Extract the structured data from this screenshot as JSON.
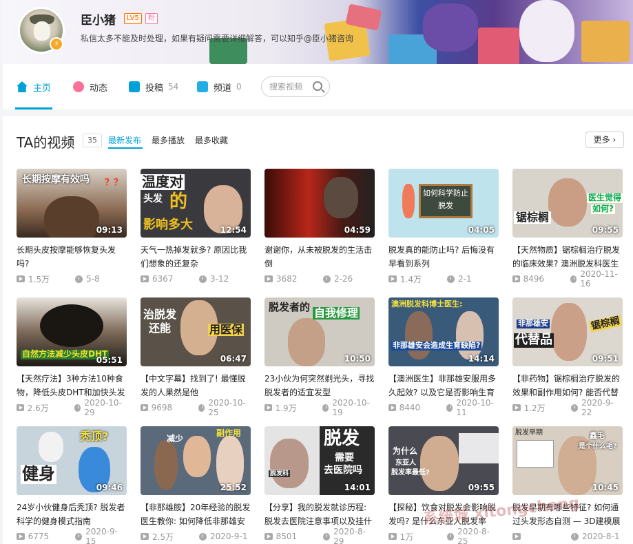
{
  "profile": {
    "name": "臣小猪",
    "level": "LV5",
    "fan_badge": "粉",
    "signature": "私信太多不能及时处理，如果有疑问需要详细解答，可以知乎@臣小猪咨询"
  },
  "nav": {
    "home": "主页",
    "dynamic": "动态",
    "uploads": "投稿",
    "uploads_count": "54",
    "channels": "频道",
    "channels_count": "0",
    "search_placeholder": "搜索视频"
  },
  "section": {
    "title": "TA的视频",
    "count": "35",
    "sort_latest": "最新发布",
    "sort_most_played": "最多播放",
    "sort_most_fav": "最多收藏",
    "more": "更多"
  },
  "videos": [
    {
      "title": "长期头皮按摩能够恢复头发吗?",
      "views": "1.5万",
      "date": "5-8",
      "duration": "09:13",
      "caption": "长期按摩有效吗",
      "caption2": "？？"
    },
    {
      "title": "天气一热掉发就多? 原因比我们想象的还复杂",
      "views": "6367",
      "date": "3-12",
      "duration": "12:54",
      "caption": "温度对",
      "caption2": "头发",
      "caption3": "的",
      "caption4": "影响多大"
    },
    {
      "title": "谢谢你，从未被脱发的生活击倒",
      "views": "3682",
      "date": "2-26",
      "duration": "04:59"
    },
    {
      "title": "脱发真的能防止吗? 后悔没有早看到系列",
      "views": "1.4万",
      "date": "2-1",
      "duration": "04:05",
      "caption": "如何科学防止",
      "caption2": "脱发"
    },
    {
      "title": "【天然物质】锯棕榈治疗脱发的临床效果? 澳洲脱发科医生",
      "views": "8496",
      "date": "2020-11-16",
      "duration": "09:55",
      "caption": "锯棕榈",
      "caption2": "医生觉得",
      "caption3": "如何?"
    },
    {
      "title": "【天然疗法】3种方法10种食物，降低头皮DHT和加快头发",
      "views": "2.6万",
      "date": "2020-10-29",
      "duration": "05:51",
      "caption": "自然方法减少头皮DHT"
    },
    {
      "title": "【中文字幕】找到了! 最懂脱发的人果然是他",
      "views": "9698",
      "date": "2020-10-25",
      "duration": "06:47",
      "caption": "治脱发",
      "caption2": "还能",
      "caption3": "用医保"
    },
    {
      "title": "23小伙为何突然剃光头，寻找脱发者的适宜发型",
      "views": "1.9万",
      "date": "2020-10-19",
      "duration": "10:50",
      "caption": "脱发者的",
      "caption2": "自我修理"
    },
    {
      "title": "【澳洲医生】非那雄安服用多久起效? 以及它是否影响生育",
      "views": "8440",
      "date": "2020-10-11",
      "duration": "14:14",
      "caption": "澳洲脱发科博士医生:",
      "caption2": "非那雄安会造成生育缺陷?"
    },
    {
      "title": "【非药物】锯棕榈治疗脱发的效果和副作用如何? 能否代替",
      "views": "1.2万",
      "date": "2020-9-22",
      "duration": "09:51",
      "caption": "非那雄安",
      "caption2": "代替品",
      "caption3": "锯棕榈"
    },
    {
      "title": "24岁小伙健身后秃顶? 脱发者科学的健身模式指南",
      "views": "6775",
      "date": "2020-9-15",
      "duration": "09:46",
      "caption": "秃顶?",
      "caption2": "健身"
    },
    {
      "title": "【非那雄胺】20年经验的脱发医生教你: 如何降低非那雄安",
      "views": "2.5万",
      "date": "2020-9-1",
      "duration": "25:52",
      "caption": "减少",
      "caption2": "副作用"
    },
    {
      "title": "【分享】我的脱发就诊历程: 脱发去医院注意事项以及挂什",
      "views": "8501",
      "date": "2020-8-29",
      "duration": "14:01",
      "caption": "脱发",
      "caption2": "需要",
      "caption3": "去医院吗",
      "caption4": "脱发科"
    },
    {
      "title": "【探秘】饮食对脱发会影响脱发吗? 是什么东亚人脱发率",
      "views": "1万",
      "date": "2020-8-25",
      "duration": "09:55",
      "caption": "为什么",
      "caption2": "东亚人",
      "caption3": "脱发率最低?"
    },
    {
      "title": "脱发早期有哪些特征? 如何通过头发形态自测 — 3D建模展",
      "views": "",
      "date": "2020-8-1",
      "duration": "10:45",
      "caption": "脱发早期",
      "caption2": "鑫毛",
      "caption3": "是个什么毛?"
    }
  ],
  "watermark": "系统城 xitongcheng",
  "colors": {
    "accent": "#00a1d6",
    "banner_dark": "#3d4fa3"
  }
}
